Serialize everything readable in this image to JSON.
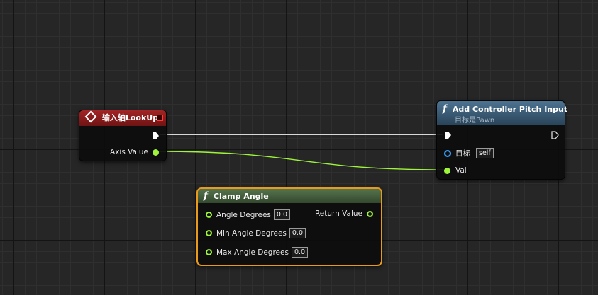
{
  "colors": {
    "event_header": "#8f1b1b",
    "function_header": "#3d5f7a",
    "pure_header": "#46603f",
    "float_pin": "#9ef53a",
    "object_pin": "#3ba3ff",
    "selection": "#e89a1c"
  },
  "nodes": {
    "input_axis": {
      "title": "输入轴LookUp",
      "axis_value_label": "Axis Value"
    },
    "add_pitch": {
      "title": "Add Controller Pitch Input",
      "subtitle": "目标是Pawn",
      "target_label": "目标",
      "target_value": "self",
      "val_label": "Val"
    },
    "clamp_angle": {
      "title": "Clamp Angle",
      "inputs": [
        {
          "label": "Angle Degrees",
          "value": "0.0"
        },
        {
          "label": "Min Angle Degrees",
          "value": "0.0"
        },
        {
          "label": "Max Angle Degrees",
          "value": "0.0"
        }
      ],
      "return_label": "Return Value"
    }
  },
  "icons": {
    "event": "diamond-icon",
    "function": "function-icon",
    "exec": "exec-arrow-icon"
  }
}
